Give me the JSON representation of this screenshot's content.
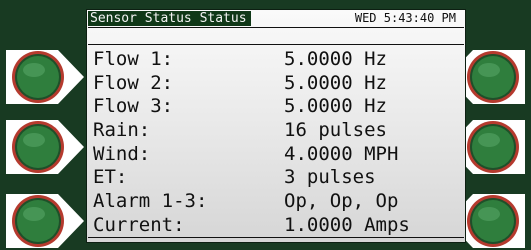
{
  "header": {
    "title": "Sensor Status Status",
    "datetime": "WED 5:43:40 PM"
  },
  "rows": [
    {
      "label": "Flow 1:",
      "value": "5.0000 Hz"
    },
    {
      "label": "Flow 2:",
      "value": "5.0000 Hz"
    },
    {
      "label": "Flow 3:",
      "value": "5.0000 Hz"
    },
    {
      "label": "Rain:",
      "value": "16 pulses"
    },
    {
      "label": "Wind:",
      "value": "4.0000 MPH"
    },
    {
      "label": "ET:",
      "value": "3 pulses"
    },
    {
      "label": "Alarm 1-3:",
      "value": "Op, Op, Op"
    },
    {
      "label": "Current:",
      "value": "1.0000 Amps"
    }
  ],
  "colors": {
    "background": "#183a22",
    "button_face": "#2e7a3c",
    "button_ring": "#c0392b"
  }
}
